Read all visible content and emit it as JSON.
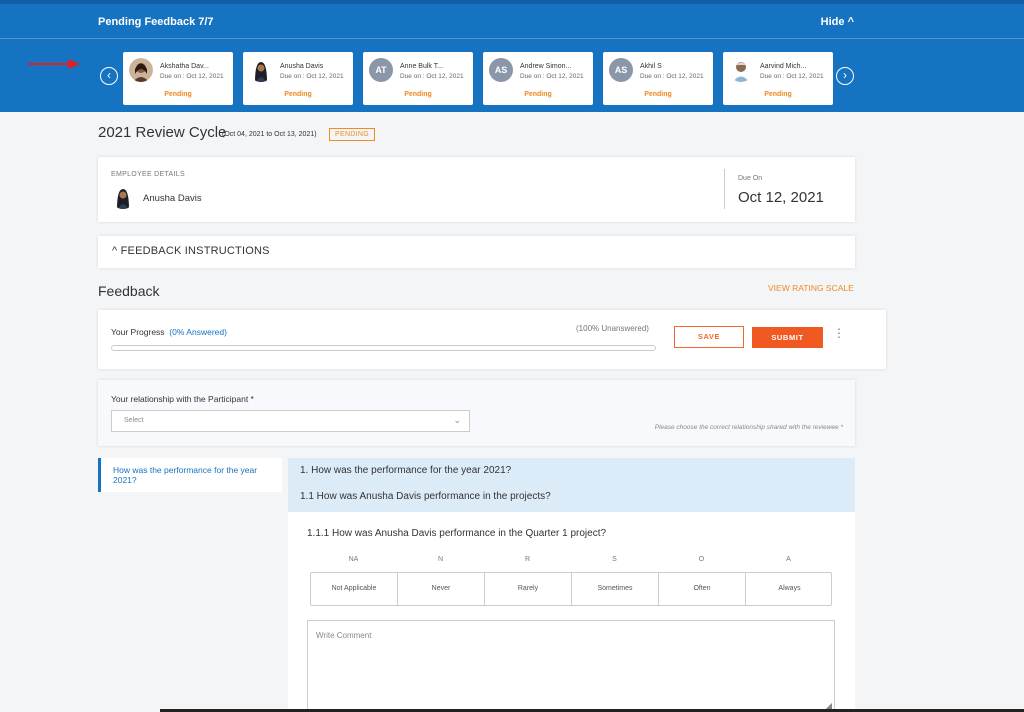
{
  "topbar": {
    "title": "Pending Feedback 7/7",
    "hide_label": "Hide ^"
  },
  "nav": {
    "prev": "‹",
    "next": "›"
  },
  "reviewees": [
    {
      "name": "Akshatha Dav...",
      "due": "Due on : Oct 12, 2021",
      "status": "Pending",
      "initials": ""
    },
    {
      "name": "Anusha Davis",
      "due": "Due on : Oct 12, 2021",
      "status": "Pending",
      "initials": ""
    },
    {
      "name": "Anne Bulk T...",
      "due": "Due on : Oct 12, 2021",
      "status": "Pending",
      "initials": "AT"
    },
    {
      "name": "Andrew Simon...",
      "due": "Due on : Oct 12, 2021",
      "status": "Pending",
      "initials": "AS"
    },
    {
      "name": "Akhil S",
      "due": "Due on : Oct 12, 2021",
      "status": "Pending",
      "initials": "AS"
    },
    {
      "name": "Aarvind Mich...",
      "due": "Due on : Oct 12, 2021",
      "status": "Pending",
      "initials": ""
    }
  ],
  "cycle": {
    "title": "2021 Review Cycle",
    "range": "(Oct 04, 2021 to Oct 13, 2021)",
    "status": "PENDING"
  },
  "employee": {
    "section_label": "EMPLOYEE DETAILS",
    "name": "Anusha Davis",
    "due_label": "Due On",
    "due_value": "Oct 12, 2021"
  },
  "instructions": {
    "label": "^   FEEDBACK INSTRUCTIONS"
  },
  "feedback": {
    "heading": "Feedback",
    "view_rating": "VIEW RATING SCALE"
  },
  "progress": {
    "label": "Your Progress",
    "answered": "(0% Answered)",
    "unanswered": "(100% Unanswered)",
    "fraction": 0,
    "save": "SAVE",
    "submit": "SUBMIT",
    "more": "⋮"
  },
  "relationship": {
    "label": "Your relationship with the Participant *",
    "placeholder": "Select",
    "hint": "Please choose the correct relationship shared with the reviewee *"
  },
  "side_nav": {
    "item": "How was the performance for the year 2021?"
  },
  "questions": {
    "q1": "1. How was the performance for the year 2021?",
    "q11": "1.1 How was Anusha Davis performance in the projects?",
    "q111": "1.1.1 How was Anusha Davis performance in the Quarter 1 project?"
  },
  "scale": [
    {
      "abbr": "NA",
      "label": "Not Applicable"
    },
    {
      "abbr": "N",
      "label": "Never"
    },
    {
      "abbr": "R",
      "label": "Rarely"
    },
    {
      "abbr": "S",
      "label": "Sometimes"
    },
    {
      "abbr": "O",
      "label": "Often"
    },
    {
      "abbr": "A",
      "label": "Always"
    }
  ],
  "comment": {
    "placeholder": "Write Comment"
  },
  "colors": {
    "brand": "#1573c2",
    "accent": "#f05a22",
    "pending": "#f08a24"
  }
}
